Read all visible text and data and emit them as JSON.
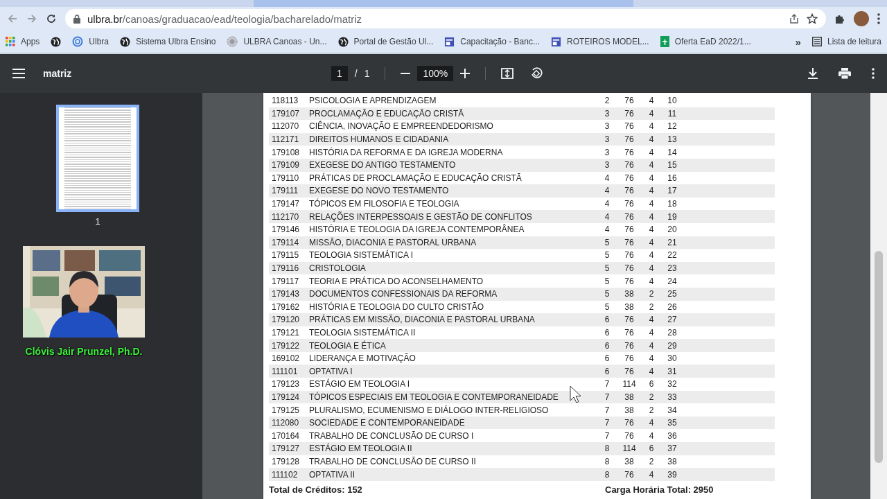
{
  "browser": {
    "url_domain": "ulbra.br",
    "url_path": "/canoas/graduacao/ead/teologia/bacharelado/matriz"
  },
  "bookmarks": [
    {
      "label": "Apps",
      "kind": "apps"
    },
    {
      "kind": "globe"
    },
    {
      "label": "Ulbra",
      "kind": "ring"
    },
    {
      "label": "Sistema Ulbra Ensino",
      "kind": "globe"
    },
    {
      "label": "ULBRA Canoas - Un...",
      "kind": "seal"
    },
    {
      "label": "Portal de Gestão Ul...",
      "kind": "globe"
    },
    {
      "label": "Capacitação - Banc...",
      "kind": "form"
    },
    {
      "label": "ROTEIROS MODEL...",
      "kind": "form"
    },
    {
      "label": "Oferta EaD 2022/1...",
      "kind": "sheet"
    }
  ],
  "bookmarks_overflow": "»",
  "reading_list": "Lista de leitura",
  "pdf_toolbar": {
    "title": "matriz",
    "page": "1",
    "separator": "/",
    "page_total": "1",
    "zoom": "100%"
  },
  "sidebar": {
    "thumbnails": [
      {
        "label": "1",
        "selected": true
      }
    ],
    "video": {
      "kind": "picture",
      "caption": "Clóvis Jair Prunzel, Ph.D."
    }
  },
  "table": {
    "rows": [
      [
        "118113",
        "PSICOLOGIA E APRENDIZAGEM",
        "2",
        "76",
        "4",
        "10"
      ],
      [
        "179107",
        "PROCLAMAÇÃO E EDUCAÇÃO CRISTÃ",
        "3",
        "76",
        "4",
        "11"
      ],
      [
        "112070",
        "CIÊNCIA, INOVAÇÃO E EMPREENDEDORISMO",
        "3",
        "76",
        "4",
        "12"
      ],
      [
        "112171",
        "DIREITOS HUMANOS E CIDADANIA",
        "3",
        "76",
        "4",
        "13"
      ],
      [
        "179108",
        "HISTÓRIA DA REFORMA E DA IGREJA MODERNA",
        "3",
        "76",
        "4",
        "14"
      ],
      [
        "179109",
        "EXEGESE DO ANTIGO TESTAMENTO",
        "3",
        "76",
        "4",
        "15"
      ],
      [
        "179110",
        "PRÁTICAS DE PROCLAMAÇÃO E EDUCAÇÃO CRISTÃ",
        "4",
        "76",
        "4",
        "16"
      ],
      [
        "179111",
        "EXEGESE DO NOVO TESTAMENTO",
        "4",
        "76",
        "4",
        "17"
      ],
      [
        "179147",
        "TÓPICOS EM FILOSOFIA E TEOLOGIA",
        "4",
        "76",
        "4",
        "18"
      ],
      [
        "112170",
        "RELAÇÕES INTERPESSOAIS E GESTÃO DE CONFLITOS",
        "4",
        "76",
        "4",
        "19"
      ],
      [
        "179146",
        "HISTÓRIA E TEOLOGIA DA IGREJA CONTEMPORÂNEA",
        "4",
        "76",
        "4",
        "20"
      ],
      [
        "179114",
        "MISSÃO, DIACONIA E PASTORAL URBANA",
        "5",
        "76",
        "4",
        "21"
      ],
      [
        "179115",
        "TEOLOGIA SISTEMÁTICA I",
        "5",
        "76",
        "4",
        "22"
      ],
      [
        "179116",
        "CRISTOLOGIA",
        "5",
        "76",
        "4",
        "23"
      ],
      [
        "179117",
        "TEORIA E PRÁTICA DO ACONSELHAMENTO",
        "5",
        "76",
        "4",
        "24"
      ],
      [
        "179143",
        "DOCUMENTOS CONFESSIONAIS DA REFORMA",
        "5",
        "38",
        "2",
        "25"
      ],
      [
        "179162",
        "HISTÓRIA E TEOLOGIA DO CULTO CRISTÃO",
        "5",
        "38",
        "2",
        "26"
      ],
      [
        "179120",
        "PRÁTICAS EM MISSÃO, DIACONIA E PASTORAL URBANA",
        "6",
        "76",
        "4",
        "27"
      ],
      [
        "179121",
        "TEOLOGIA SISTEMÁTICA II",
        "6",
        "76",
        "4",
        "28"
      ],
      [
        "179122",
        "TEOLOGIA E ÉTICA",
        "6",
        "76",
        "4",
        "29"
      ],
      [
        "169102",
        "LIDERANÇA E MOTIVAÇÃO",
        "6",
        "76",
        "4",
        "30"
      ],
      [
        "111101",
        "OPTATIVA I",
        "6",
        "76",
        "4",
        "31"
      ],
      [
        "179123",
        "ESTÁGIO EM TEOLOGIA I",
        "7",
        "114",
        "6",
        "32"
      ],
      [
        "179124",
        "TÓPICOS ESPECIAIS EM TEOLOGIA E CONTEMPORANEIDADE",
        "7",
        "38",
        "2",
        "33"
      ],
      [
        "179125",
        "PLURALISMO, ECUMENISMO E DIÁLOGO INTER-RELIGIOSO",
        "7",
        "38",
        "2",
        "34"
      ],
      [
        "112080",
        "SOCIEDADE E CONTEMPORANEIDADE",
        "7",
        "76",
        "4",
        "35"
      ],
      [
        "170164",
        "TRABALHO DE CONCLUSÃO DE CURSO I",
        "7",
        "76",
        "4",
        "36"
      ],
      [
        "179127",
        "ESTÁGIO EM TEOLOGIA II",
        "8",
        "114",
        "6",
        "37"
      ],
      [
        "179128",
        "TRABALHO DE CONCLUSÃO DE CURSO II",
        "8",
        "38",
        "2",
        "38"
      ],
      [
        "111102",
        "OPTATIVA II",
        "8",
        "76",
        "4",
        "39"
      ]
    ]
  },
  "totals": [
    "Total de Créditos: 152",
    "Carga Horária Total: 2950"
  ]
}
